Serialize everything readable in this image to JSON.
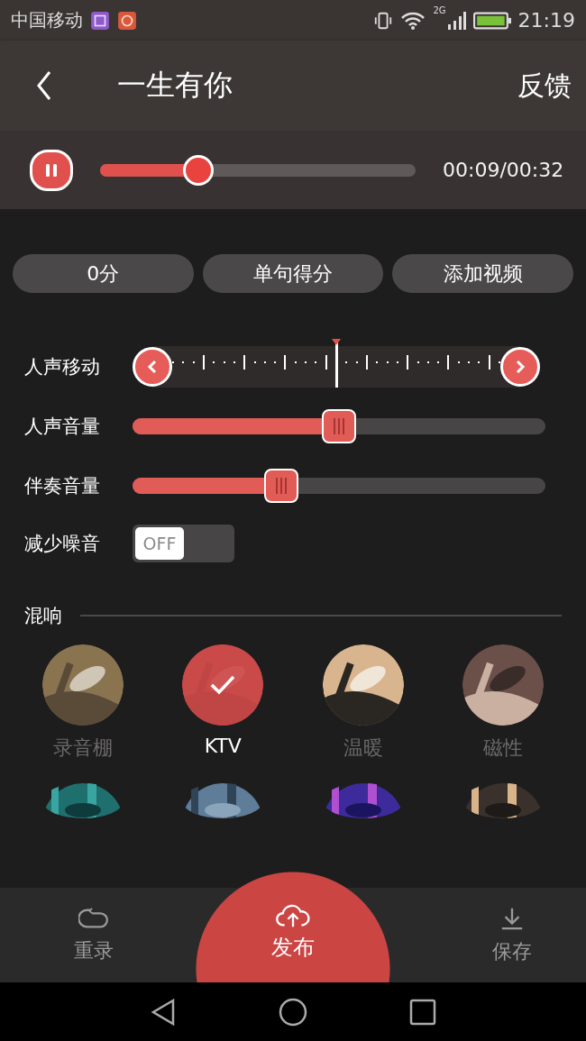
{
  "status_bar": {
    "carrier": "中国移动",
    "network": "2G",
    "time": "21:19"
  },
  "header": {
    "title": "一生有你",
    "action": "反馈"
  },
  "player": {
    "playing": true,
    "level": 0.31,
    "time": "00:09/00:32"
  },
  "score_buttons": [
    "0分",
    "单句得分",
    "添加视频"
  ],
  "controls": [
    {
      "kind": "shift",
      "label": "人声移动",
      "level": 0.5
    },
    {
      "kind": "slider",
      "label": "人声音量",
      "level": 0.5
    },
    {
      "kind": "slider",
      "label": "伴奏音量",
      "level": 0.36
    },
    {
      "kind": "toggle",
      "label": "减少噪音",
      "on": false,
      "state_text": "OFF"
    }
  ],
  "reverb": {
    "title": "混响",
    "items": [
      {
        "label": "录音棚",
        "selected": false
      },
      {
        "label": "KTV",
        "selected": true
      },
      {
        "label": "温暖",
        "selected": false
      },
      {
        "label": "磁性",
        "selected": false
      },
      {
        "kind": "picture"
      },
      {
        "kind": "picture"
      },
      {
        "kind": "picture"
      },
      {
        "kind": "picture"
      }
    ]
  },
  "bottom_bar": {
    "items": [
      {
        "kind": "redo",
        "label": "重录"
      },
      {
        "kind": "publish",
        "label": "发布"
      },
      {
        "kind": "save",
        "label": "保存"
      }
    ]
  }
}
